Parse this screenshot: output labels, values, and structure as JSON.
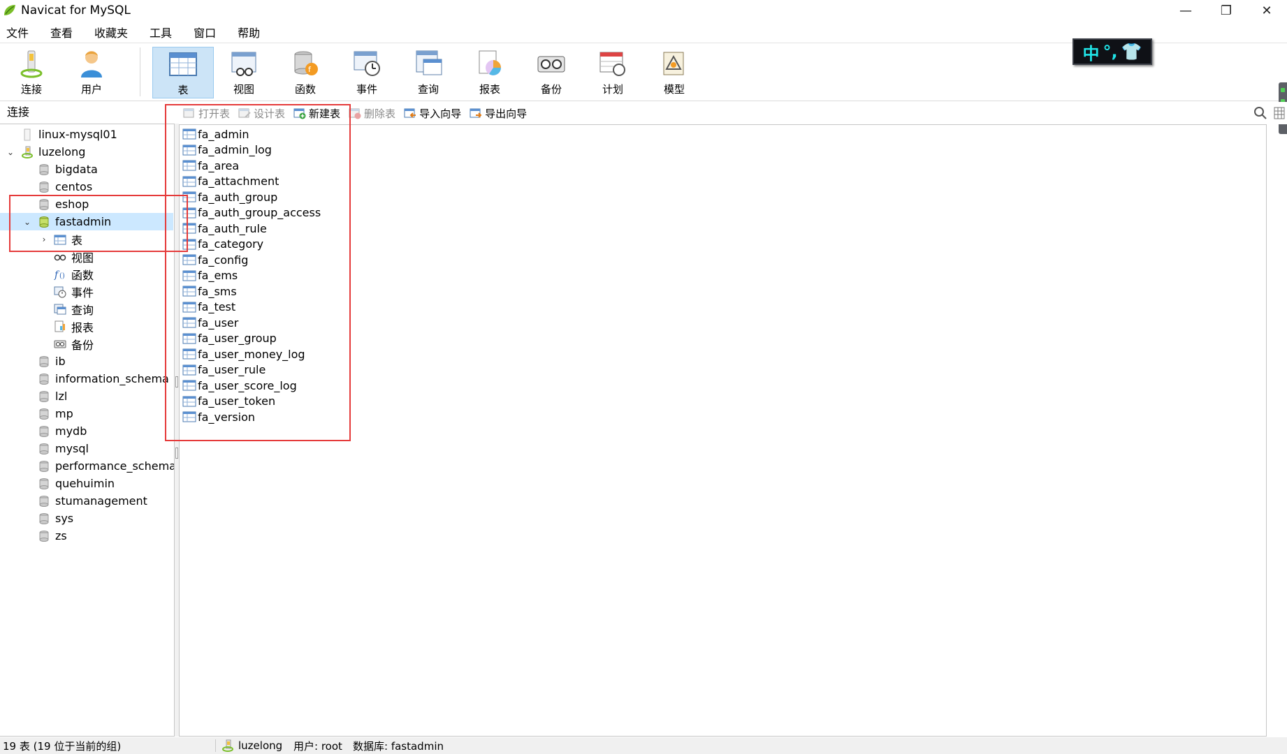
{
  "window": {
    "title": "Navicat for MySQL",
    "controls": {
      "minimize": "—",
      "maximize": "❐",
      "close": "✕"
    }
  },
  "menu": [
    "文件",
    "查看",
    "收藏夹",
    "工具",
    "窗口",
    "帮助"
  ],
  "toolbar": {
    "buttons": [
      {
        "label": "连接",
        "icon": "connection-icon"
      },
      {
        "label": "用户",
        "icon": "user-icon"
      },
      {
        "label": "表",
        "icon": "table-icon",
        "active": true
      },
      {
        "label": "视图",
        "icon": "view-icon"
      },
      {
        "label": "函数",
        "icon": "function-icon"
      },
      {
        "label": "事件",
        "icon": "event-icon"
      },
      {
        "label": "查询",
        "icon": "query-icon"
      },
      {
        "label": "报表",
        "icon": "report-icon"
      },
      {
        "label": "备份",
        "icon": "backup-icon"
      },
      {
        "label": "计划",
        "icon": "schedule-icon"
      },
      {
        "label": "模型",
        "icon": "model-icon"
      }
    ]
  },
  "ime": {
    "mode": "中",
    "punct": "°,",
    "skin": "👕"
  },
  "left_panel": {
    "header": "连接",
    "tree": [
      {
        "label": "linux-mysql01",
        "type": "connection-off",
        "level": 0
      },
      {
        "label": "luzelong",
        "type": "connection-on",
        "level": 0,
        "expanded": true
      },
      {
        "label": "bigdata",
        "type": "database",
        "level": 1
      },
      {
        "label": "centos",
        "type": "database",
        "level": 1
      },
      {
        "label": "eshop",
        "type": "database",
        "level": 1
      },
      {
        "label": "fastadmin",
        "type": "database-open",
        "level": 1,
        "expanded": true,
        "selected": true
      },
      {
        "label": "表",
        "type": "tables",
        "level": 2,
        "collapsed": true
      },
      {
        "label": "视图",
        "type": "views",
        "level": 2
      },
      {
        "label": "函数",
        "type": "functions",
        "level": 2
      },
      {
        "label": "事件",
        "type": "events",
        "level": 2
      },
      {
        "label": "查询",
        "type": "queries",
        "level": 2
      },
      {
        "label": "报表",
        "type": "reports",
        "level": 2
      },
      {
        "label": "备份",
        "type": "backups",
        "level": 2
      },
      {
        "label": "ib",
        "type": "database",
        "level": 1
      },
      {
        "label": "information_schema",
        "type": "database",
        "level": 1
      },
      {
        "label": "lzl",
        "type": "database",
        "level": 1
      },
      {
        "label": "mp",
        "type": "database",
        "level": 1
      },
      {
        "label": "mydb",
        "type": "database",
        "level": 1
      },
      {
        "label": "mysql",
        "type": "database",
        "level": 1
      },
      {
        "label": "performance_schema",
        "type": "database",
        "level": 1
      },
      {
        "label": "quehuimin",
        "type": "database",
        "level": 1
      },
      {
        "label": "stumanagement",
        "type": "database",
        "level": 1
      },
      {
        "label": "sys",
        "type": "database",
        "level": 1
      },
      {
        "label": "zs",
        "type": "database",
        "level": 1
      }
    ]
  },
  "object_toolbar": [
    {
      "label": "打开表",
      "enabled": false,
      "icon": "open-table-icon"
    },
    {
      "label": "设计表",
      "enabled": false,
      "icon": "design-table-icon"
    },
    {
      "label": "新建表",
      "enabled": true,
      "icon": "new-table-icon"
    },
    {
      "label": "删除表",
      "enabled": false,
      "icon": "delete-table-icon"
    },
    {
      "label": "导入向导",
      "enabled": true,
      "icon": "import-wizard-icon"
    },
    {
      "label": "导出向导",
      "enabled": true,
      "icon": "export-wizard-icon"
    }
  ],
  "tables": [
    "fa_admin",
    "fa_admin_log",
    "fa_area",
    "fa_attachment",
    "fa_auth_group",
    "fa_auth_group_access",
    "fa_auth_rule",
    "fa_category",
    "fa_config",
    "fa_ems",
    "fa_sms",
    "fa_test",
    "fa_user",
    "fa_user_group",
    "fa_user_money_log",
    "fa_user_rule",
    "fa_user_score_log",
    "fa_user_token",
    "fa_version"
  ],
  "status": {
    "count": "19 表 (19 位于当前的组)",
    "connection": "luzelong",
    "user": "用户: root",
    "database": "数据库: fastadmin"
  },
  "colors": {
    "selection": "#cce8ff",
    "toolbar_active": "#cce4f7",
    "annotation_red": "#e53a3a",
    "ime_text": "#20e3e6"
  }
}
